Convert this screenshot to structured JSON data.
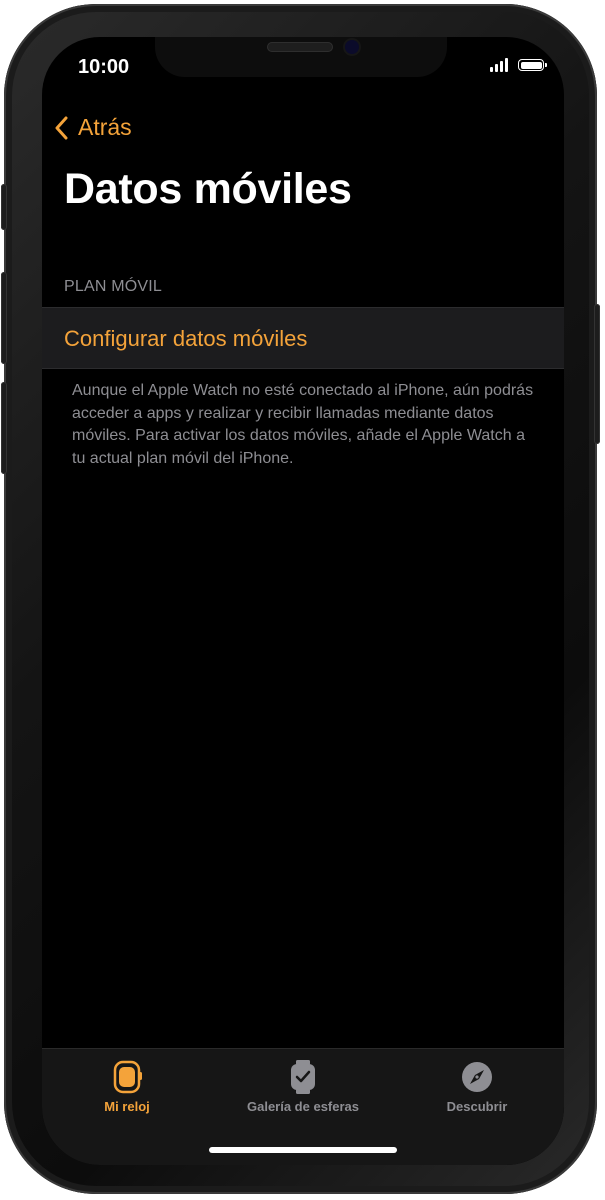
{
  "status_bar": {
    "time": "10:00"
  },
  "nav": {
    "back_label": "Atrás"
  },
  "page": {
    "title": "Datos móviles"
  },
  "section": {
    "header": "PLAN MÓVIL",
    "cell_label": "Configurar datos móviles",
    "footer": "Aunque el Apple Watch no esté conectado al iPhone, aún podrás acceder a apps y realizar y recibir llamadas mediante datos móviles. Para activar los datos móviles, añade el Apple Watch a tu actual plan móvil del iPhone."
  },
  "tab_bar": {
    "tabs": [
      {
        "label": "Mi reloj",
        "icon": "watch-icon",
        "active": true
      },
      {
        "label": "Galería de esferas",
        "icon": "watch-face-icon",
        "active": false
      },
      {
        "label": "Descubrir",
        "icon": "compass-icon",
        "active": false
      }
    ]
  },
  "colors": {
    "accent": "#f4a33a",
    "background": "#000000",
    "cell_background": "#1c1c1e",
    "secondary_text": "#8e8e93",
    "inactive_tab": "#8e8e93"
  }
}
